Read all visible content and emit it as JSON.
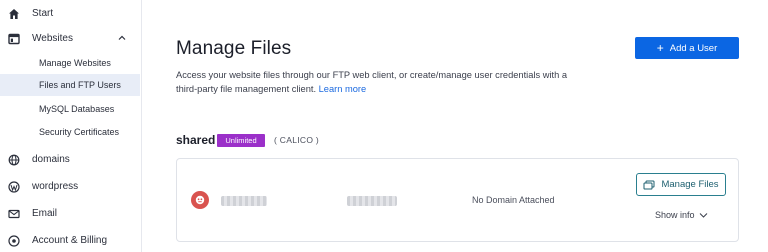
{
  "sidebar": {
    "items": [
      {
        "label": "Start",
        "icon": "home-icon"
      },
      {
        "label": "Websites",
        "icon": "websites-icon"
      },
      {
        "label": "domains",
        "icon": "globe-icon"
      },
      {
        "label": "wordpress",
        "icon": "wordpress-icon"
      },
      {
        "label": "Email",
        "icon": "envelope-icon"
      },
      {
        "label": "Account & Billing",
        "icon": "account-icon"
      }
    ],
    "websites_sub": [
      {
        "label": "Manage Websites"
      },
      {
        "label": "Files and FTP Users",
        "active": true
      },
      {
        "label": "MySQL Databases"
      },
      {
        "label": "Security Certificates"
      }
    ]
  },
  "main": {
    "title": "Manage Files",
    "description": "Access your website files through our FTP web client, or create/manage user credentials with a third-party file management client.",
    "learn_more": "Learn more",
    "add_user_label": "Add a User"
  },
  "plan": {
    "name": "shared",
    "badge": "Unlimited",
    "note": "( CALICO )"
  },
  "site_card": {
    "domain_status": "No Domain Attached",
    "manage_files_label": "Manage Files",
    "show_info_label": "Show info"
  },
  "colors": {
    "primary": "#0b66e3",
    "badge": "#9b30c9",
    "active_bg": "#e8edf7",
    "link": "#1c6ae0",
    "manage_border": "#2a7f8f"
  }
}
